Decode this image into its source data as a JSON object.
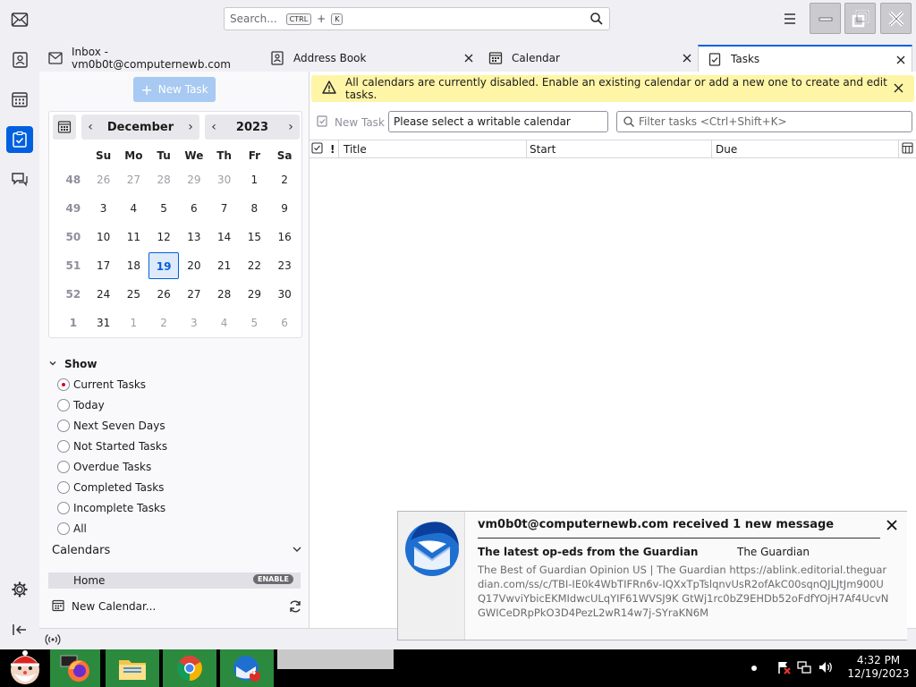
{
  "search": {
    "placeholder": "Search...",
    "kbd1": "CTRL",
    "plus": "+",
    "kbd2": "K"
  },
  "tabs": [
    {
      "label": "Inbox - vm0b0t@computernewb.com"
    },
    {
      "label": "Address Book"
    },
    {
      "label": "Calendar"
    },
    {
      "label": "Tasks"
    }
  ],
  "left": {
    "new_task": "New Task",
    "month": "December",
    "year": "2023",
    "weekdays": [
      "Su",
      "Mo",
      "Tu",
      "We",
      "Th",
      "Fr",
      "Sa"
    ],
    "weeks": [
      {
        "wk": "48",
        "days": [
          "26",
          "27",
          "28",
          "29",
          "30",
          "1",
          "2"
        ]
      },
      {
        "wk": "49",
        "days": [
          "3",
          "4",
          "5",
          "6",
          "7",
          "8",
          "9"
        ]
      },
      {
        "wk": "50",
        "days": [
          "10",
          "11",
          "12",
          "13",
          "14",
          "15",
          "16"
        ]
      },
      {
        "wk": "51",
        "days": [
          "17",
          "18",
          "19",
          "20",
          "21",
          "22",
          "23"
        ]
      },
      {
        "wk": "52",
        "days": [
          "24",
          "25",
          "26",
          "27",
          "28",
          "29",
          "30"
        ]
      },
      {
        "wk": "1",
        "days": [
          "31",
          "1",
          "2",
          "3",
          "4",
          "5",
          "6"
        ]
      }
    ],
    "show_label": "Show",
    "filters": [
      "Current Tasks",
      "Today",
      "Next Seven Days",
      "Not Started Tasks",
      "Overdue Tasks",
      "Completed Tasks",
      "Incomplete Tasks",
      "All"
    ],
    "selected_filter": "Current Tasks",
    "calendars_label": "Calendars",
    "home": "Home",
    "enable": "ENABLE",
    "new_calendar": "New Calendar..."
  },
  "main": {
    "warning": "All calendars are currently disabled. Enable an existing calendar or add a new one to create and edit tasks.",
    "new_task": "New Task",
    "calendar_select": "Please select a writable calendar",
    "filter_placeholder": "Filter tasks <Ctrl+Shift+K>",
    "columns": {
      "priority": "!",
      "title": "Title",
      "start": "Start",
      "due": "Due"
    }
  },
  "notification": {
    "title": "vm0b0t@computernewb.com received 1 new message",
    "subject": "The latest op-eds from the Guardian",
    "from": "The Guardian",
    "body": "The Best of Guardian Opinion US | The Guardian https://ablink.editorial.theguardian.com/ss/c/TBI-IE0k4WbTIFRn6v-IQXxTpTslqnvUsR2ofAkC00sqnQJLJtJm900UQ17VwviYbicEKMIdwcULqYIF61WVSJ9K GtWj1rc0bZ9EHDb52oFdfYOjH7Af4UcvNGWICeDRpPkO3D4PezL2wR14w7j-SYraKN6M"
  },
  "taskbar": {
    "badge": "4",
    "time": "4:32 PM",
    "date": "12/19/2023"
  },
  "colors": {
    "accent": "#0060df",
    "warning_bg": "#fff5a6",
    "today_bg": "#deeaf9"
  }
}
